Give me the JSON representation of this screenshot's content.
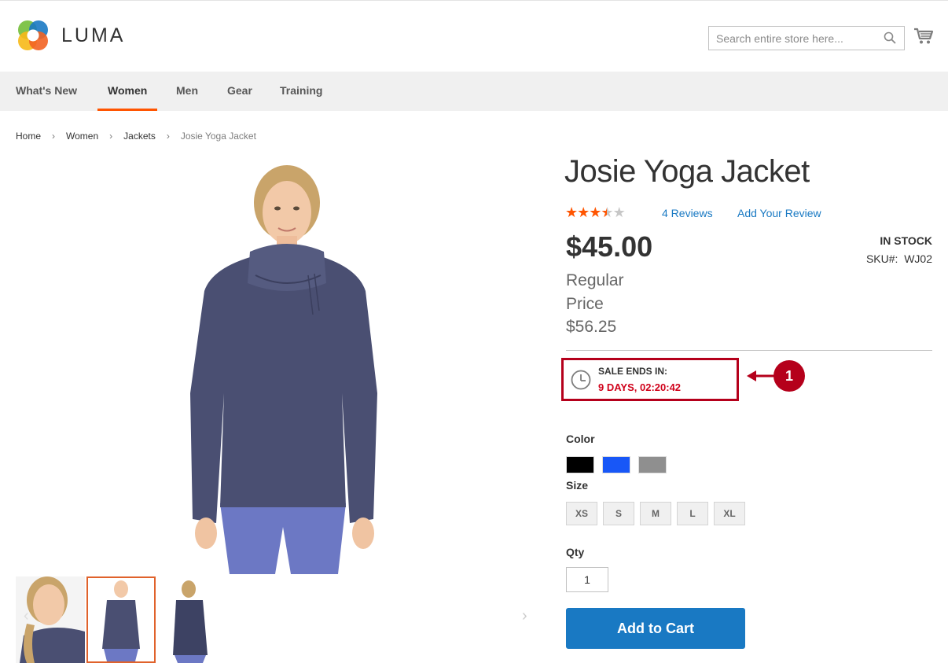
{
  "header": {
    "logo_text": "LUMA",
    "search": {
      "placeholder": "Search entire store here..."
    }
  },
  "nav": {
    "items": [
      {
        "label": "What's New"
      },
      {
        "label": "Women"
      },
      {
        "label": "Men"
      },
      {
        "label": "Gear"
      },
      {
        "label": "Training"
      }
    ],
    "active": "Women"
  },
  "breadcrumb": {
    "items": [
      "Home",
      "Women",
      "Jackets",
      "Josie Yoga Jacket"
    ],
    "separator": "›"
  },
  "product": {
    "title": "Josie Yoga Jacket",
    "rating": 3.5,
    "rating_max": 5,
    "reviews_link": "4 Reviews",
    "add_review_link": "Add Your Review",
    "price": "$45.00",
    "regular_price_label": "Regular Price",
    "regular_price": "$56.25",
    "stock_status": "IN STOCK",
    "sku_label": "SKU#:",
    "sku": "WJ02"
  },
  "sale_timer": {
    "label": "SALE ENDS IN:",
    "countdown": "9 DAYS, 02:20:42",
    "callout_number": "1",
    "accent_color": "#b5001b",
    "timer_color": "#d0021b"
  },
  "options": {
    "color_label": "Color",
    "colors": [
      "#000000",
      "#1857f7",
      "#8f8f8f"
    ],
    "size_label": "Size",
    "sizes": [
      "XS",
      "S",
      "M",
      "L",
      "XL"
    ],
    "qty_label": "Qty",
    "qty_value": "1"
  },
  "actions": {
    "add_to_cart": "Add to Cart"
  },
  "theme": {
    "brand_orange": "#ff5501",
    "link_blue": "#1979c3"
  }
}
